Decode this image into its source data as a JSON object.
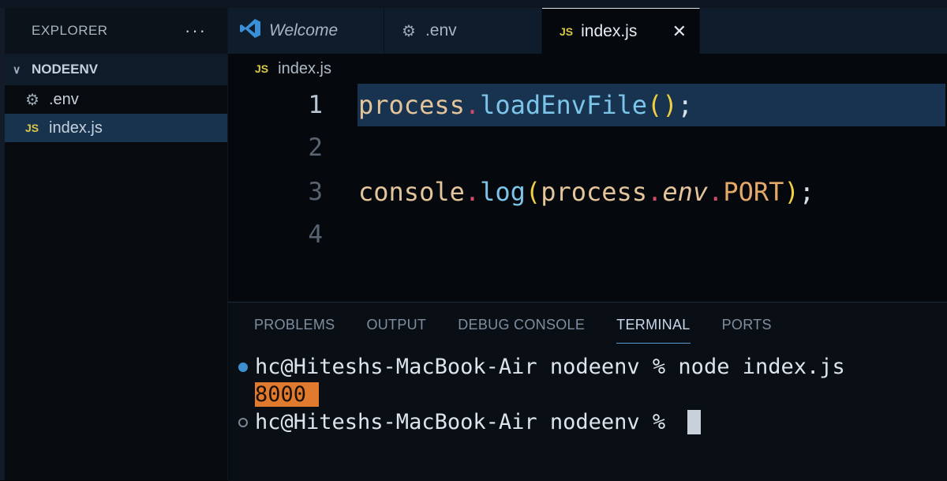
{
  "sidebar": {
    "title": "EXPLORER",
    "more": "···",
    "folder": "NODEENV",
    "files": [
      {
        "name": ".env",
        "icon": "gear-icon"
      },
      {
        "name": "index.js",
        "icon": "js-file-icon",
        "badge": "JS"
      }
    ]
  },
  "tabs": [
    {
      "label": "Welcome",
      "icon": "vscode-logo-icon"
    },
    {
      "label": ".env",
      "icon": "gear-icon"
    },
    {
      "label": "index.js",
      "icon": "js-file-icon",
      "badge": "JS",
      "close": "✕"
    }
  ],
  "breadcrumb": {
    "badge": "JS",
    "label": "index.js"
  },
  "editor": {
    "line_numbers": [
      "1",
      "2",
      "3",
      "4"
    ],
    "current_line": 1,
    "code": {
      "l1": {
        "obj": "process",
        "dot": ".",
        "fn": "loadEnvFile",
        "open": "(",
        "close": ")",
        "semi": ";"
      },
      "l3": {
        "obj": "console",
        "dot1": ".",
        "fn": "log",
        "open": "(",
        "obj2": "process",
        "dot2": ".",
        "prop": "env",
        "dot3": ".",
        "const": "PORT",
        "close": ")",
        "semi": ";"
      }
    }
  },
  "panel": {
    "tabs": [
      "PROBLEMS",
      "OUTPUT",
      "DEBUG CONSOLE",
      "TERMINAL",
      "PORTS"
    ],
    "active_tab": "TERMINAL",
    "terminal": {
      "line1": "hc@Hiteshs-MacBook-Air nodeenv % node index.js",
      "output": "8000",
      "line3": "hc@Hiteshs-MacBook-Air nodeenv % "
    }
  },
  "colors": {
    "accent": "#3d8fd0",
    "highlight_output": "#e07a2e",
    "current_line": "#173350",
    "js_badge": "#d8c84a"
  }
}
